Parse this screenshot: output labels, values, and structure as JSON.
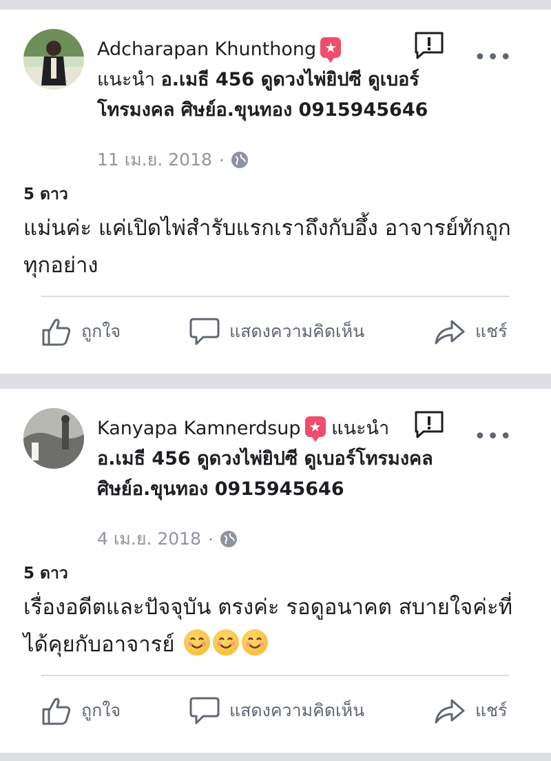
{
  "reviews": [
    {
      "author": "Adcharapan Khunthong",
      "recommends_word": "แนะนำ",
      "page_name": "อ.เมธี 456 ดูดวงไพ่ยิปซี ดูเบอร์โทรมงคล ศิษย์อ.ขุนทอง 0915945646",
      "date": "11 เม.ย. 2018",
      "separator": "·",
      "rating": "5 ดาว",
      "text": "แม่นค่ะ แค่เปิดไพ่สำรับแรกเราถึงกับอึ้ง อาจารย์ทักถูกทุกอย่าง",
      "emojis": []
    },
    {
      "author": "Kanyapa Kamnerdsup",
      "recommends_word": "แนะนำ",
      "page_name": "อ.เมธี 456 ดูดวงไพ่ยิปซี ดูเบอร์โทรมงคล ศิษย์อ.ขุนทอง 0915945646",
      "date": "4 เม.ย. 2018",
      "separator": "·",
      "rating": "5 ดาว",
      "text": "เรื่องอดีตและปัจจุบัน ตรงค่ะ รอดูอนาคต สบายใจค่ะที่ได้คุยกับอาจารย์",
      "emojis": [
        "smiling-face",
        "smiling-face",
        "smiling-face"
      ]
    }
  ],
  "actions": {
    "like": "ถูกใจ",
    "comment": "แสดงความคิดเห็น",
    "share": "แชร์"
  },
  "icons": {
    "recommend": "star-badge-icon",
    "report": "report-flag-icon",
    "more": "more-options-icon",
    "privacy": "globe-icon",
    "like": "thumbs-up-icon",
    "comment": "comment-bubble-icon",
    "share": "share-arrow-icon"
  },
  "colors": {
    "background": "#dddfe2",
    "card": "#ffffff",
    "badge": "#ee4d6d",
    "secondary_text": "#90949c"
  }
}
